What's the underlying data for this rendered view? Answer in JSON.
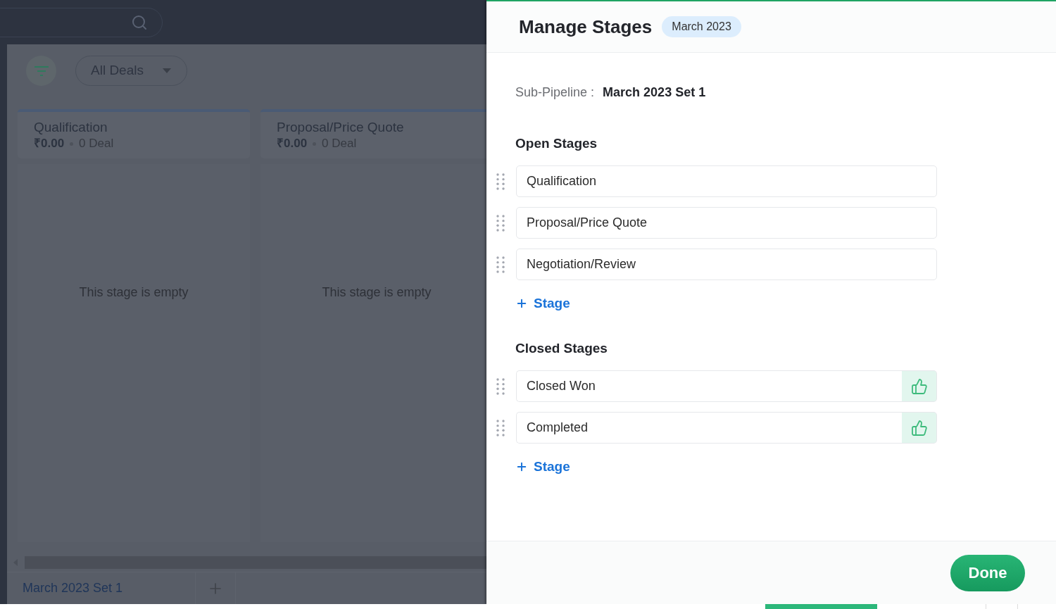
{
  "background": {
    "view_selector": {
      "label": "All Deals"
    },
    "columns": [
      {
        "title": "Qualification",
        "amount": "₹0.00",
        "deals": "0 Deal",
        "empty_message": "This stage is empty"
      },
      {
        "title": "Proposal/Price Quote",
        "amount": "₹0.00",
        "deals": "0 Deal",
        "empty_message": "This stage is empty"
      }
    ],
    "pipeline_tabs": [
      {
        "label": "March 2023 Set 1",
        "selected": true
      }
    ]
  },
  "panel": {
    "title": "Manage Stages",
    "badge": "March 2023",
    "sub_pipeline": {
      "label": "Sub-Pipeline :",
      "value": "March 2023 Set 1"
    },
    "sections": [
      {
        "title": "Open Stages",
        "stages": [
          {
            "name": "Qualification",
            "kind": "open"
          },
          {
            "name": "Proposal/Price Quote",
            "kind": "open"
          },
          {
            "name": "Negotiation/Review",
            "kind": "open"
          }
        ],
        "add_button": "Stage"
      },
      {
        "title": "Closed Stages",
        "stages": [
          {
            "name": "Closed Won",
            "kind": "won"
          },
          {
            "name": "Completed",
            "kind": "won"
          }
        ],
        "add_button": "Stage"
      }
    ],
    "done_button": "Done"
  }
}
